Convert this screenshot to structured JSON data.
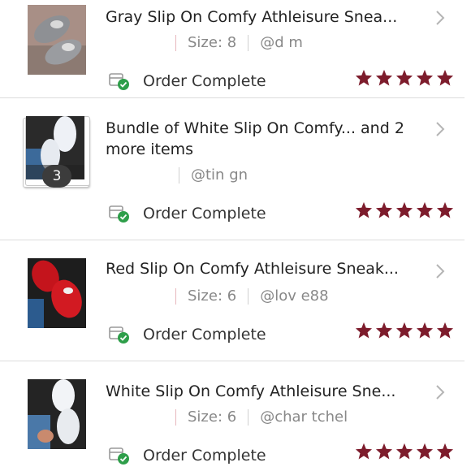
{
  "colors": {
    "star": "#7d1c2c",
    "check": "#2e9e4a",
    "divider": "#dcdcdc",
    "meta": "#888888"
  },
  "orders": [
    {
      "title": "Gray Slip On Comfy Athleisure Sneа...",
      "size": "Size: 8",
      "seller": "@d          m",
      "status": "Order Complete",
      "rating": 5,
      "thumb_icon": "gray-sneakers-photo"
    },
    {
      "title": "Bundle of White Slip On Comfy... and 2 more items",
      "size": "",
      "seller": "@tin          gn",
      "status": "Order Complete",
      "rating": 5,
      "bundle_count": "3",
      "thumb_icon": "white-sneakers-photo"
    },
    {
      "title": "Red Slip On Comfy Athleisure Sneak...",
      "size": "Size: 6",
      "seller": "@lov          e88",
      "status": "Order Complete",
      "rating": 5,
      "thumb_icon": "red-sneakers-photo"
    },
    {
      "title": "White Slip On Comfy Athleisure Sne...",
      "size": "Size: 6",
      "seller": "@char          tchel",
      "status": "Order Complete",
      "rating": 5,
      "thumb_icon": "white-sneakers-photo"
    }
  ]
}
